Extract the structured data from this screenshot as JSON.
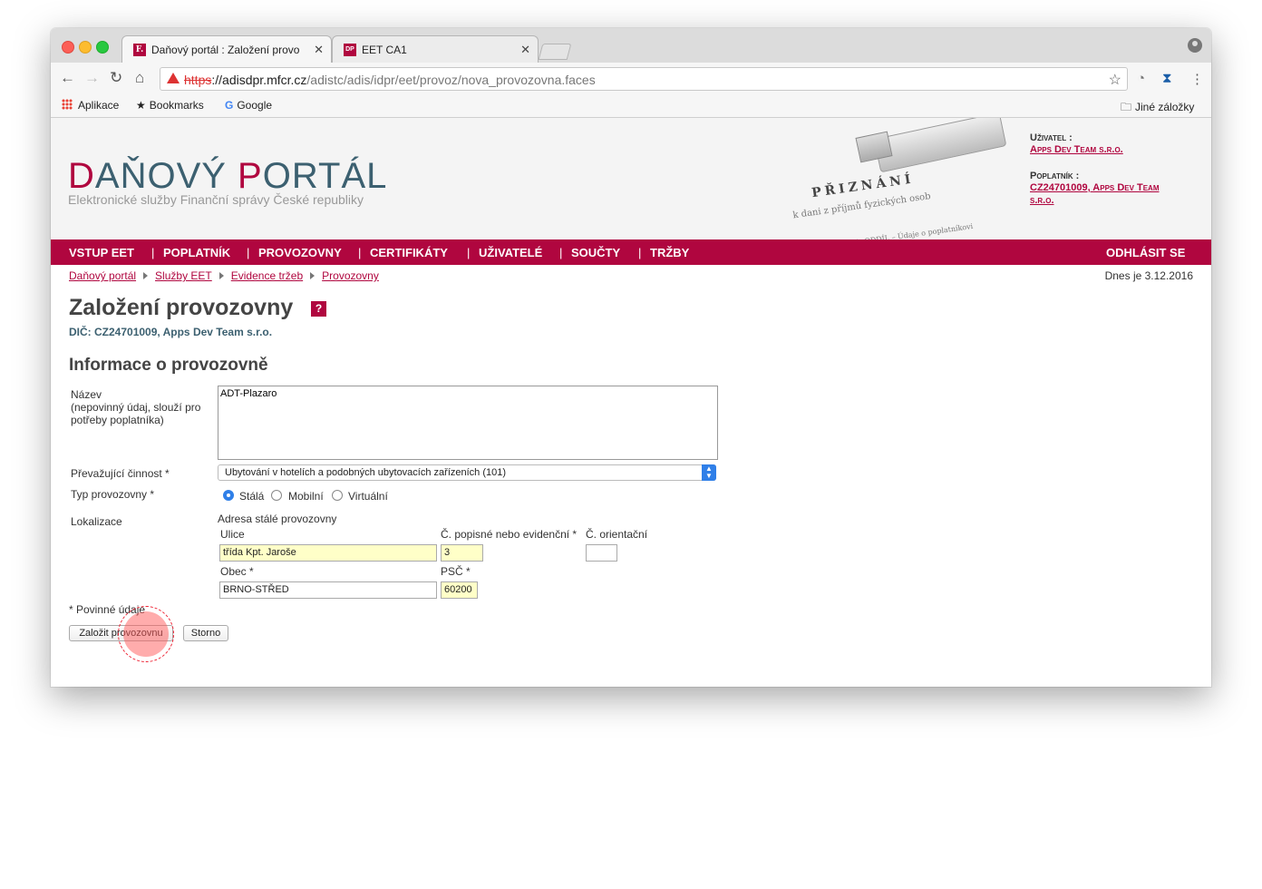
{
  "browser": {
    "tabs": [
      {
        "label": "Daňový portál : Založení provo",
        "favicon": "F.",
        "active": true
      },
      {
        "label": "EET CA1",
        "favicon": "DP",
        "active": false
      }
    ],
    "url": {
      "scheme": "https",
      "host": "://adisdpr.mfcr.cz",
      "path": "/adistc/adis/idpr/eet/provoz/nova_provozovna.faces"
    },
    "bookmarks": [
      "Aplikace",
      "Bookmarks",
      "Google"
    ],
    "other_bookmarks": "Jiné záložky"
  },
  "header": {
    "logo_d": "D",
    "logo_rest1": "AŇOVÝ ",
    "logo_p": "P",
    "logo_rest2": "ORTÁL",
    "subtitle": "Elektronické služby Finanční správy České republiky",
    "user_label": "Uživatel :",
    "user_name": "Apps Dev Team s.r.o.",
    "taxpayer_label": "Poplatník :",
    "taxpayer_line1": "CZ24701009, Apps Dev Team",
    "taxpayer_line2": "s.r.o.",
    "hero_title": "PŘIZNÁNÍ",
    "hero_line1": "k dani z příjmů fyzických osob",
    "hero_line2": "1. ODDÍL – Údaje o poplatníkovi"
  },
  "nav": {
    "items": [
      "VSTUP EET",
      "POPLATNÍK",
      "PROVOZOVNY",
      "CERTIFIKÁTY",
      "UŽIVATELÉ",
      "SOUČTY",
      "TRŽBY"
    ],
    "logout": "ODHLÁSIT SE"
  },
  "breadcrumb": [
    "Daňový portál",
    "Služby EET",
    "Evidence tržeb",
    "Provozovny"
  ],
  "today": "Dnes je 3.12.2016",
  "page_title": "Založení provozovny",
  "help": "?",
  "dic": "DIČ: CZ24701009, Apps Dev Team s.r.o.",
  "section_title": "Informace o provozovně",
  "form": {
    "name_label": "Název",
    "name_hint1": "(nepovinný údaj, slouží pro",
    "name_hint2": "potřeby poplatníka)",
    "name_value": "ADT-Plazaro",
    "activity_label": "Převažující činnost *",
    "activity_value": "Ubytování v hotelích a podobných ubytovacích zařízeních (101)",
    "type_label": "Typ provozovny *",
    "type_options": [
      "Stálá",
      "Mobilní",
      "Virtuální"
    ],
    "type_selected": "Stálá",
    "location_label": "Lokalizace",
    "address_title": "Adresa stálé provozovny",
    "street_label": "Ulice",
    "street_value": "třída Kpt. Jaroše",
    "house_no_label": "Č. popisné nebo evidenční *",
    "house_no_value": "3",
    "orient_label": "Č. orientační",
    "orient_value": "",
    "city_label": "Obec *",
    "city_value": "BRNO-STŘED",
    "zip_label": "PSČ *",
    "zip_value": "60200",
    "required_note": "* Povinné údaje",
    "submit_label": "Založit provozovnu",
    "cancel_label": "Storno"
  },
  "colors": {
    "brand": "#b0063f",
    "teal": "#3c6070",
    "required_fill": "#ffffc8"
  }
}
